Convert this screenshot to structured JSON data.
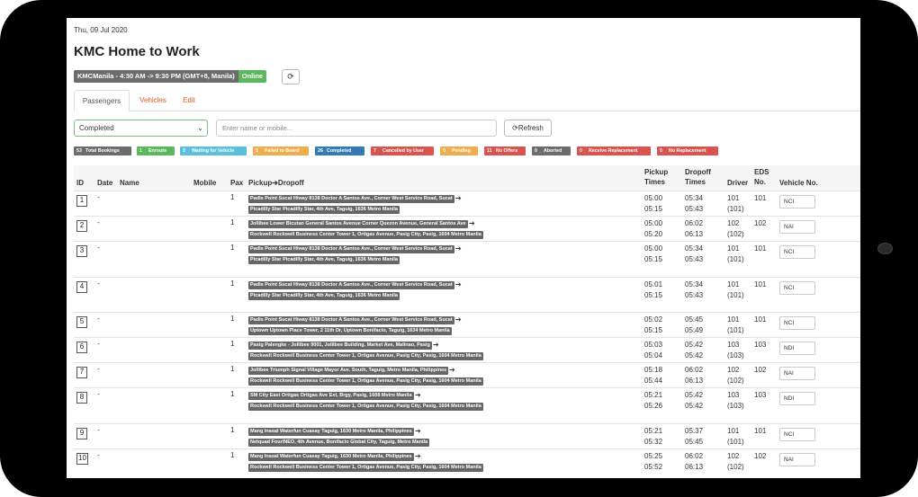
{
  "header": {
    "date": "Thu, 09 Jul 2020",
    "title": "KMC Home to Work",
    "shift_label": "KMCManila - 4:30 AM -> 9:30 PM (GMT+8, Manila)",
    "shift_status": "Online",
    "sync_icon": "⟳"
  },
  "tabs": [
    {
      "label": "Passengers"
    },
    {
      "label": "Vehicles"
    },
    {
      "label": "Edit"
    }
  ],
  "filters": {
    "status_value": "Completed",
    "chevron": "⌄",
    "search_placeholder": "Enter name or mobile...",
    "refresh_label": "⟳Refresh"
  },
  "badges": [
    {
      "count": "53",
      "label": "Total Bookings",
      "color": "#6c6c6c"
    },
    {
      "count": "1",
      "label": "Enroute",
      "color": "#5cb85c"
    },
    {
      "count": "2",
      "label": "Waiting for Vehicle",
      "color": "#5bc0de"
    },
    {
      "count": "5",
      "label": "Failed to Board",
      "color": "#f0ad4e"
    },
    {
      "count": "26",
      "label": "Completed",
      "color": "#337ab7"
    },
    {
      "count": "7",
      "label": "Cancelled by User",
      "color": "#d9534f"
    },
    {
      "count": "0",
      "label": "Pending",
      "color": "#f0ad4e"
    },
    {
      "count": "11",
      "label": "No Offers",
      "color": "#d9534f"
    },
    {
      "count": "0",
      "label": "Aborted",
      "color": "#6c6c6c"
    },
    {
      "count": "0",
      "label": "Receive Replacement",
      "color": "#d9534f"
    },
    {
      "count": "0",
      "label": "No Replacement",
      "color": "#d9534f"
    }
  ],
  "table": {
    "headers": {
      "id": "ID",
      "date": "Date",
      "name": "Name",
      "mobile": "Mobile",
      "pax": "Pax",
      "pickup_dropoff": "Pickup➔Dropoff",
      "pickup_times_1": "Pickup",
      "pickup_times_2": "Times",
      "dropoff_times_1": "Dropoff",
      "dropoff_times_2": "Times",
      "driver": "Driver",
      "eds_1": "EDS",
      "eds_2": "No.",
      "vehicle": "Vehicle No."
    },
    "rows": [
      {
        "id": "1",
        "date": "-",
        "pax": "1",
        "pickup": "Padis Point Sucat Hiway 8138 Doctor A Santos Ave., Corner West Service Road, Sucat",
        "dropoff": "Picadilly Star Picadilly Star, 4th Ave, Taguig, 1636 Metro Manila",
        "pt1": "05:00",
        "pt2": "05:15",
        "dt1": "05:34",
        "dt2": "05:43",
        "drv1": "101",
        "drv2": "(101)",
        "eds": "101",
        "veh": "NCI"
      },
      {
        "id": "2",
        "date": "-",
        "pax": "1",
        "pickup": "Jollibee Lower Bicutan General Santos Avenue Corner Quezon Avenue, General Santos Ave",
        "dropoff": "Rockwell Rockwell Business Center Tower 1, Ortigas Avenue, Pasig City, Pasig, 1604 Metro Manila",
        "pt1": "05:00",
        "pt2": "05:20",
        "dt1": "06:02",
        "dt2": "06:13",
        "drv1": "102",
        "drv2": "(102)",
        "eds": "102",
        "veh": "NAI"
      },
      {
        "id": "3",
        "date": "-",
        "pax": "1",
        "pickup": "Padis Point Sucat Hiway 8138 Doctor A Santos Ave., Corner West Service Road, Sucat",
        "dropoff": "Picadilly Star Picadilly Star, 4th Ave, Taguig, 1636 Metro Manila",
        "pt1": "05:00",
        "pt2": "05:15",
        "dt1": "05:34",
        "dt2": "05:43",
        "drv1": "101",
        "drv2": "(101)",
        "eds": "101",
        "veh": "NCI"
      },
      {
        "id": "4",
        "date": "-",
        "pax": "1",
        "pickup": "Padis Point Sucat Hiway 8138 Doctor A Santos Ave., Corner West Service Road, Sucat",
        "dropoff": "Picadilly Star Picadilly Star, 4th Ave, Taguig, 1636 Metro Manila",
        "pt1": "05:01",
        "pt2": "05:15",
        "dt1": "05:34",
        "dt2": "05:43",
        "drv1": "101",
        "drv2": "(101)",
        "eds": "101",
        "veh": "NCI"
      },
      {
        "id": "5",
        "date": "-",
        "pax": "1",
        "pickup": "Padis Point Sucat Hiway 8138 Doctor A Santos Ave., Corner West Service Road, Sucat",
        "dropoff": "Uptown Uptown Place Tower, 2 11th Dr, Uptown Bonifacio, Taguig, 1634 Metro Manila",
        "pt1": "05:02",
        "pt2": "05:15",
        "dt1": "05:45",
        "dt2": "05:49",
        "drv1": "101",
        "drv2": "(101)",
        "eds": "101",
        "veh": "NCI"
      },
      {
        "id": "6",
        "date": "-",
        "pax": "1",
        "pickup": "Pasig Palengke - Jollibee 9001, Jollibee Building, Market Ave, Malinao, Pasig",
        "dropoff": "Rockwell Rockwell Business Center Tower 1, Ortigas Avenue, Pasig City, Pasig, 1604 Metro Manila",
        "pt1": "05:03",
        "pt2": "05:04",
        "dt1": "05:42",
        "dt2": "05:42",
        "drv1": "103",
        "drv2": "(103)",
        "eds": "103",
        "veh": "NDI"
      },
      {
        "id": "7",
        "date": "-",
        "pax": "1",
        "pickup": "Jollibee Triumph Signal Village Mayor Ave. South, Taguig, Metro Manila, Philippines",
        "dropoff": "Rockwell Rockwell Business Center Tower 1, Ortigas Avenue, Pasig City, Pasig, 1604 Metro Manila",
        "pt1": "05:18",
        "pt2": "05:44",
        "dt1": "06:02",
        "dt2": "06:13",
        "drv1": "102",
        "drv2": "(102)",
        "eds": "102",
        "veh": "NAI"
      },
      {
        "id": "8",
        "date": "-",
        "pax": "1",
        "pickup": "SM City East Ortigas Ortigas Ave Ext, Brgy, Pasig, 1608 Metro Manila",
        "dropoff": "Rockwell Rockwell Business Center Tower 1, Ortigas Avenue, Pasig City, Pasig, 1604 Metro Manila",
        "pt1": "05:21",
        "pt2": "05:26",
        "dt1": "05:42",
        "dt2": "05:42",
        "drv1": "103",
        "drv2": "(103)",
        "eds": "103",
        "veh": "NDI"
      },
      {
        "id": "9",
        "date": "-",
        "pax": "1",
        "pickup": "Mang Inasal Waterfun Cuasay Taguig, 1630 Metro Manila, Philippines",
        "dropoff": "Netquad Four/NEO, 4th Avenue, Bonifacio Global City, Taguig, Metro Manila",
        "pt1": "05:21",
        "pt2": "05:32",
        "dt1": "05:37",
        "dt2": "05:45",
        "drv1": "101",
        "drv2": "(101)",
        "eds": "101",
        "veh": "NCI"
      },
      {
        "id": "10",
        "date": "-",
        "pax": "1",
        "pickup": "Mang Inasal Waterfun Cuasay Taguig, 1630 Metro Manila, Philippines",
        "dropoff": "Rockwell Rockwell Business Center Tower 1, Ortigas Avenue, Pasig City, Pasig, 1604 Metro Manila",
        "pt1": "05:25",
        "pt2": "05:52",
        "dt1": "06:02",
        "dt2": "06:13",
        "drv1": "102",
        "drv2": "(102)",
        "eds": "102",
        "veh": "NAI"
      }
    ]
  }
}
